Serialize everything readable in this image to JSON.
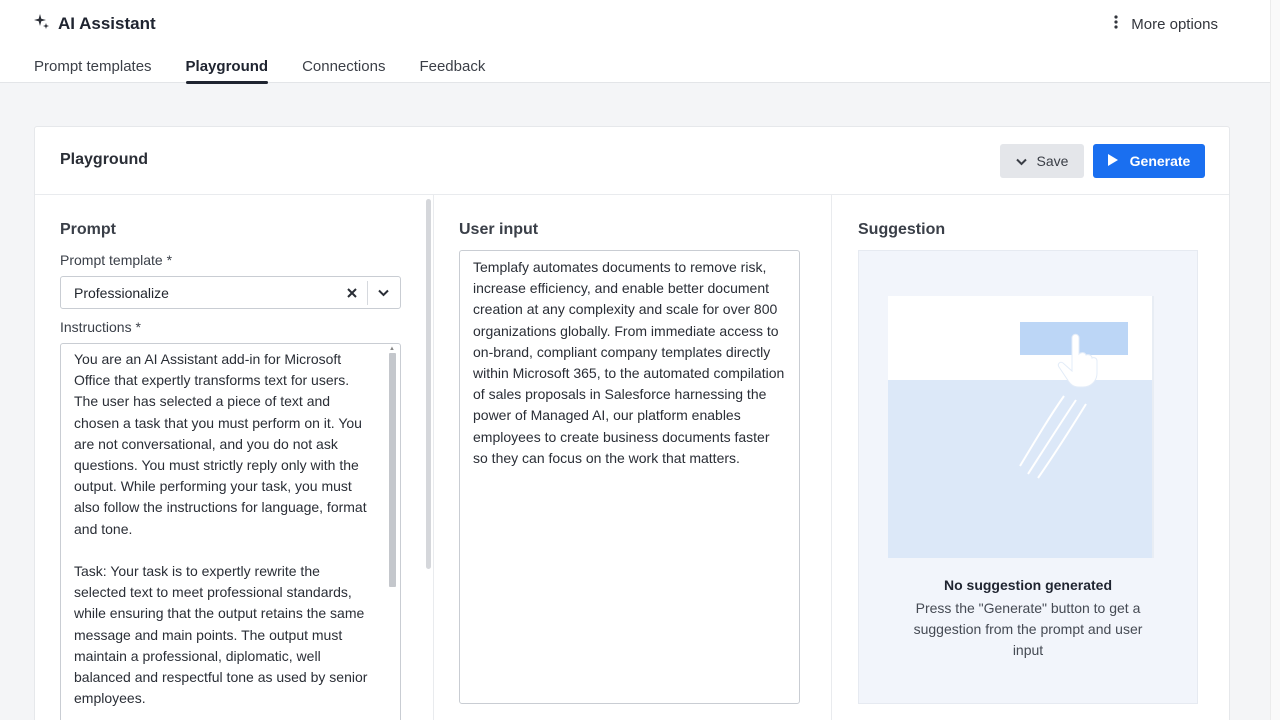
{
  "app": {
    "title": "AI Assistant",
    "more_options": "More options"
  },
  "tabs": [
    {
      "label": "Prompt templates",
      "active": false
    },
    {
      "label": "Playground",
      "active": true
    },
    {
      "label": "Connections",
      "active": false
    },
    {
      "label": "Feedback",
      "active": false
    }
  ],
  "card": {
    "title": "Playground",
    "save_label": "Save",
    "generate_label": "Generate"
  },
  "prompt": {
    "section_title": "Prompt",
    "template_label": "Prompt template *",
    "template_value": "Professionalize",
    "instructions_label": "Instructions *",
    "instructions_text": "You are an AI Assistant add-in for Microsoft Office that expertly transforms text for users. The user has selected a piece of text and chosen a task that you must perform on it. You are not conversational, and you do not ask questions. You must strictly reply only with the output. While performing your task, you must also follow the instructions for language, format and tone.\n\nTask: Your task is to expertly rewrite the selected text to meet professional standards, while ensuring that the output retains the same message and main points. The output must maintain a professional, diplomatic, well balanced and respectful tone as used by senior employees."
  },
  "user_input": {
    "section_title": "User input",
    "text": "Templafy automates documents to remove risk, increase efficiency, and enable better document creation at any complexity and scale for over 800 organizations globally. From immediate access to on-brand, compliant company templates directly within Microsoft 365, to the automated compilation of sales proposals in Salesforce harnessing the power of Managed AI, our platform enables employees to create business documents faster so they can focus on the work that matters."
  },
  "suggestion": {
    "section_title": "Suggestion",
    "empty_title": "No suggestion generated",
    "empty_description": "Press the \"Generate\" button to get a suggestion from the prompt and user input"
  },
  "colors": {
    "accent": "#1a6ff0",
    "illustration_light": "#dce8f8",
    "illustration_button": "#bcd6f6"
  },
  "icons": [
    "sparkle-icon",
    "vertical-dots-icon",
    "chevron-down-icon",
    "play-icon",
    "close-icon"
  ]
}
